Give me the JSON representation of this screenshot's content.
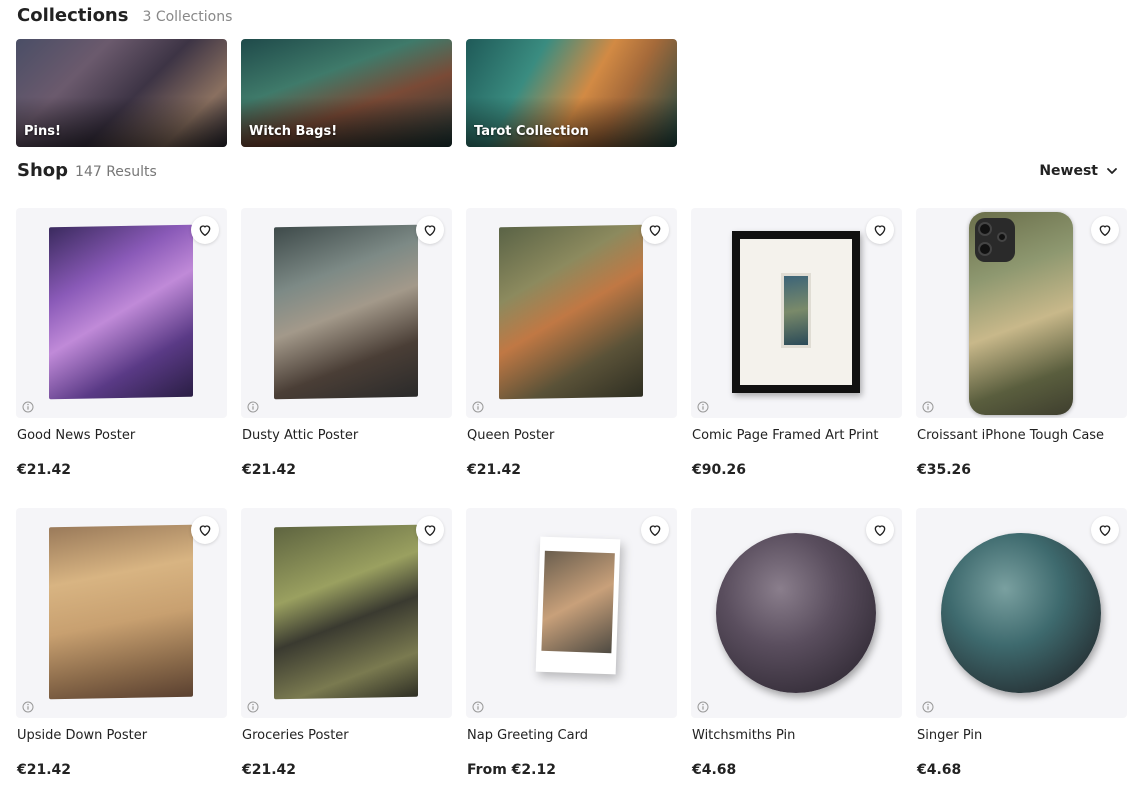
{
  "collections": {
    "title": "Collections",
    "count": "3 Collections",
    "items": [
      {
        "label": "Pins!"
      },
      {
        "label": "Witch Bags!"
      },
      {
        "label": "Tarot Collection"
      }
    ]
  },
  "shop": {
    "title": "Shop",
    "count": "147 Results",
    "sort_label": "Newest"
  },
  "products": [
    {
      "name": "Good News Poster",
      "price": "€21.42"
    },
    {
      "name": "Dusty Attic Poster",
      "price": "€21.42"
    },
    {
      "name": "Queen Poster",
      "price": "€21.42"
    },
    {
      "name": "Comic Page Framed Art Print",
      "price": "€90.26"
    },
    {
      "name": "Croissant iPhone Tough Case",
      "price": "€35.26"
    },
    {
      "name": "Upside Down Poster",
      "price": "€21.42"
    },
    {
      "name": "Groceries Poster",
      "price": "€21.42"
    },
    {
      "name": "Nap Greeting Card",
      "price": "From €2.12"
    },
    {
      "name": "Witchsmiths Pin",
      "price": "€4.68"
    },
    {
      "name": "Singer Pin",
      "price": "€4.68"
    }
  ],
  "icons": {
    "favorite": "heart-icon",
    "info": "info-icon",
    "sort": "chevron-down-icon"
  },
  "colors": {
    "text": "#222222",
    "muted": "#888888",
    "card_bg": "#f5f5f8"
  }
}
